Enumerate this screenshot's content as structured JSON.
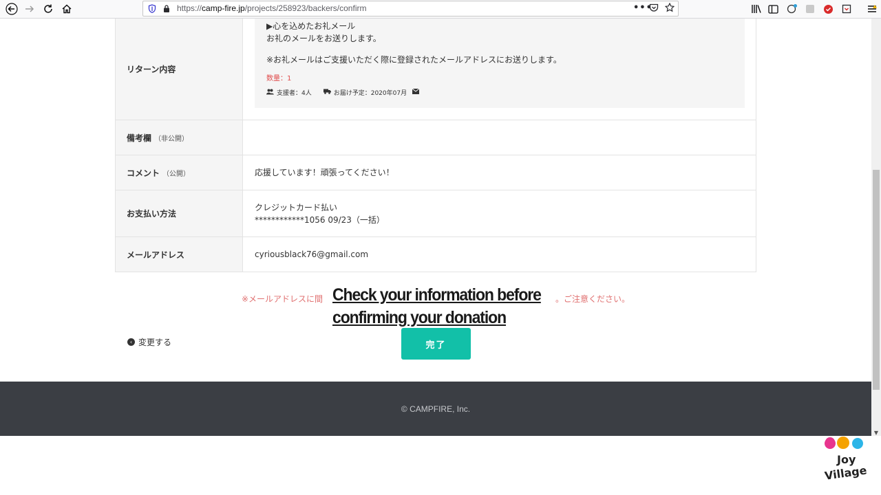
{
  "browser": {
    "url_prefix": "https://",
    "url_domain": "camp-fire.jp",
    "url_path": "/projects/258923/backers/confirm",
    "page_actions": "•••"
  },
  "reward": {
    "label": "リターン内容",
    "line1": "▶心を込めたお礼メール",
    "line2": "お礼のメールをお送りします。",
    "line3": "※お礼メールはご支援いただく際に登録されたメールアドレスにお送りします。",
    "quantity": "数量：1",
    "backers": "支援者：4人",
    "delivery": "お届け予定：2020年07月"
  },
  "rows": {
    "remarks": {
      "label": "備考欄",
      "sub": "（非公開）",
      "value": ""
    },
    "comment": {
      "label": "コメント",
      "sub": "（公開）",
      "value": "応援しています！頑張ってください！"
    },
    "payment": {
      "label": "お支払い方法",
      "value1": "クレジットカード払い",
      "value2": "************1056 09/23（一括）"
    },
    "email": {
      "label": "メールアドレス",
      "value": "cyriousblack76@gmail.com"
    }
  },
  "notice_left": "※メールアドレスに間",
  "notice_right": "。ご注意ください。",
  "back_label": "変更する",
  "done_label": "完了",
  "footer": "© CAMPFIRE, Inc.",
  "caption": {
    "line1": "Check your information before",
    "line2": "confirming your donation"
  },
  "colors": {
    "accent": "#12c0a8",
    "notice": "#e07070",
    "footer_bg": "#3b3e44"
  }
}
